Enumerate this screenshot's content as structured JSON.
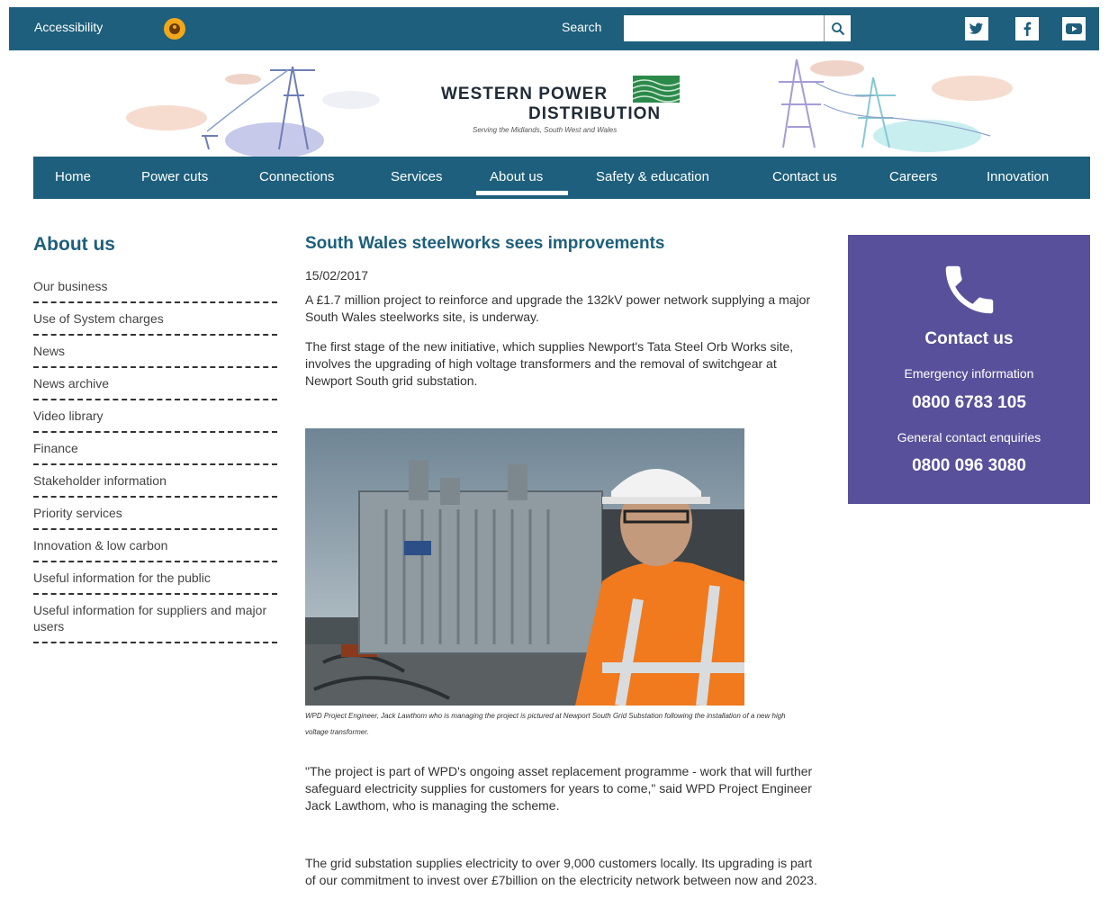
{
  "topbar": {
    "accessibility_label": "Accessibility",
    "search_label": "Search",
    "search_placeholder": "",
    "social": [
      "twitter-icon",
      "facebook-icon",
      "youtube-icon"
    ]
  },
  "brand": {
    "line1": "WESTERN POWER",
    "line2": "DISTRIBUTION",
    "tagline": "Serving the Midlands, South West and Wales"
  },
  "nav": {
    "items": [
      "Home",
      "Power cuts",
      "Connections",
      "Services",
      "About us",
      "Safety & education",
      "Contact us",
      "Careers",
      "Innovation"
    ],
    "active": "About us"
  },
  "sidebar": {
    "title": "About us",
    "items": [
      "Our business",
      "Use of System charges",
      "News",
      "News archive",
      "Video library",
      "Finance",
      "Stakeholder information",
      "Priority services",
      "Innovation & low carbon",
      "Useful information for the public",
      "Useful information for suppliers and major users"
    ]
  },
  "article": {
    "title": "South Wales steelworks sees improvements",
    "date": "15/02/2017",
    "p1": "A £1.7 million project to reinforce and upgrade the 132kV power network supplying a major South Wales steelworks site, is underway.",
    "p2": "The first stage of the new initiative, which supplies Newport's Tata Steel Orb Works site, involves the upgrading of high voltage transformers and the removal of switchgear at Newport South grid substation.",
    "caption": "WPD Project Engineer, Jack Lawthom who is managing the project is pictured at Newport South Grid Substation following the installation of a new high voltage transformer.",
    "p3": "\"The project is part of WPD's ongoing asset replacement programme - work that will further safeguard electricity supplies for customers for years to come,\" said WPD Project Engineer Jack Lawthom, who is managing the scheme.",
    "p4": "The grid substation supplies electricity to over 9,000 customers locally. Its upgrading is part of our commitment to invest over £7billion on the electricity network between now and 2023."
  },
  "contact": {
    "title": "Contact us",
    "emergency_label": "Emergency information",
    "emergency_number": "0800 6783 105",
    "general_label": "General contact enquiries",
    "general_number": "0800 096 3080"
  },
  "colors": {
    "brand_teal": "#1d5f7c",
    "contact_purple": "#58509a",
    "accessibility_orange": "#f2a71b"
  }
}
